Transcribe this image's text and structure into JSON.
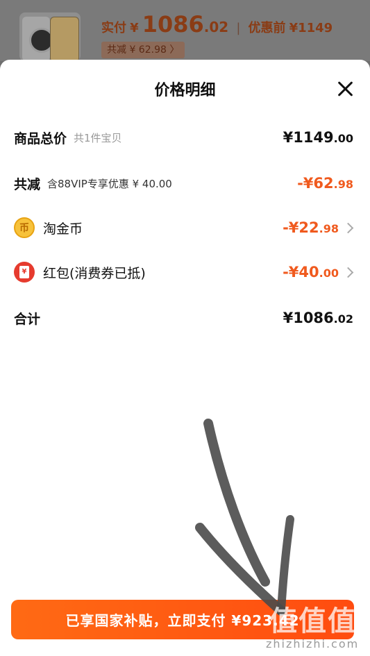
{
  "header": {
    "paid_label": "实付",
    "currency": "¥",
    "paid_int": "1086",
    "paid_dec": ".02",
    "before_label": "优惠前",
    "before_price": "¥1149",
    "discount_chip": "共减 ¥ 62.98 〉"
  },
  "sheet": {
    "title": "价格明细",
    "rows": [
      {
        "name": "商品总价",
        "sub": "共1件宝贝",
        "amount_int": "¥1149",
        "amount_dec": ".00"
      },
      {
        "name": "共减",
        "sub": "含88VIP专享优惠 ¥ 40.00",
        "amount_int": "-¥62",
        "amount_dec": ".98"
      },
      {
        "icon_text": "币",
        "name": "淘金币",
        "amount_int": "-¥22",
        "amount_dec": ".98"
      },
      {
        "icon_text": "¥",
        "name": "红包(消费券已抵)",
        "amount_int": "-¥40",
        "amount_dec": ".00"
      },
      {
        "name": "合计",
        "amount_int": "¥1086",
        "amount_dec": ".02"
      }
    ]
  },
  "pay_button": {
    "label": "已享国家补贴，立即支付 ¥923.42"
  },
  "watermark": {
    "cn": "值值值",
    "url": "zhizhizhi.com"
  },
  "colors": {
    "accent": "#ff5a14",
    "discount": "#f05a1e"
  }
}
